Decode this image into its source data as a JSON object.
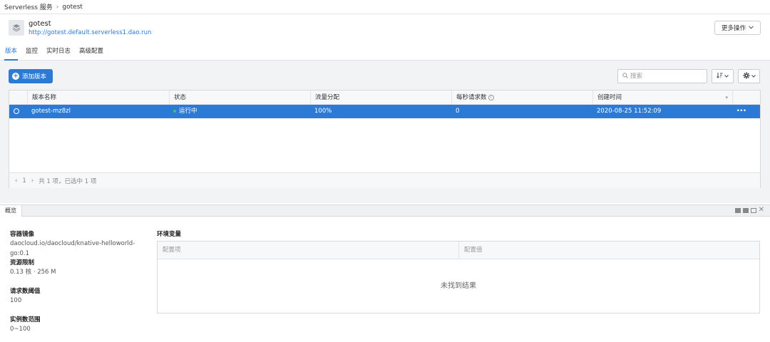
{
  "breadcrumb": {
    "root": "Serverless 服务",
    "separator": "›",
    "current": "gotest"
  },
  "app": {
    "title": "gotest",
    "url": "http://gotest.default.serverless1.dao.run",
    "more_actions": "更多操作"
  },
  "tabs": [
    {
      "label": "版本",
      "active": true
    },
    {
      "label": "监控",
      "active": false
    },
    {
      "label": "实时日志",
      "active": false
    },
    {
      "label": "高级配置",
      "active": false
    }
  ],
  "toolbar": {
    "add_version": "添加版本",
    "search_placeholder": "搜索"
  },
  "table": {
    "columns": [
      "版本名称",
      "状态",
      "流量分配",
      "每秒请求数",
      "创建时间"
    ],
    "rows": [
      {
        "name": "gotest-mz8zl",
        "status": "运行中",
        "traffic": "100%",
        "rps": "0",
        "created": "2020-08-25 11:52:09",
        "selected": true
      }
    ],
    "pager": {
      "prev": "‹",
      "page": "1",
      "next": "›",
      "summary": "共 1 项，已选中 1 项"
    }
  },
  "panel": {
    "tab": "概览",
    "info": [
      {
        "label": "容器镜像",
        "value": "daocloud.io/daocloud/knative-helloworld-go:0.1"
      },
      {
        "label": "资源限制",
        "value": "0.13 核 · 256 M"
      },
      {
        "label": "请求数阈值",
        "value": "100"
      },
      {
        "label": "实例数范围",
        "value": "0~100"
      }
    ],
    "env": {
      "title": "环境变量",
      "col_key": "配置项",
      "col_value": "配置值",
      "empty": "未找到结果"
    }
  },
  "colors": {
    "accent": "#2b7bd6",
    "running": "#3cc46b",
    "work_bg": "#f2f3f5"
  },
  "icons": [
    "layers-icon",
    "chevron-down-icon",
    "plus-circle-icon",
    "search-icon",
    "sort-icon",
    "gear-icon",
    "info-icon",
    "more-horizontal-icon",
    "close-icon"
  ]
}
